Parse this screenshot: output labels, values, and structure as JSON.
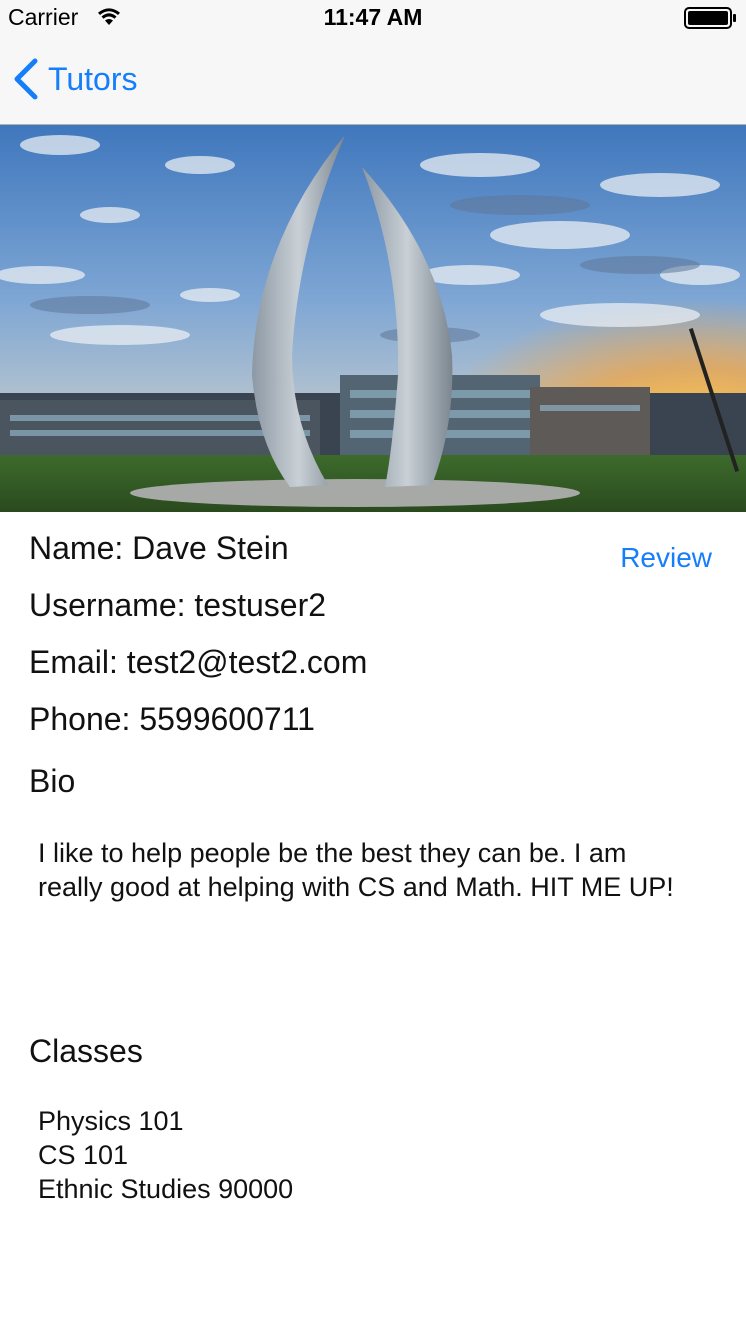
{
  "status_bar": {
    "carrier": "Carrier",
    "time": "11:47 AM"
  },
  "nav": {
    "back_label": "Tutors",
    "accent_color": "#157efb"
  },
  "hero_image": {
    "description_icon": "campus-sculpture-photo"
  },
  "profile": {
    "name": "Name: Dave Stein",
    "username": "Username: testuser2",
    "email": "Email: test2@test2.com",
    "phone": "Phone: 5599600711",
    "review_label": "Review"
  },
  "bio": {
    "title": "Bio",
    "text": "I like to help people be the best they can be. I am really good at helping with CS and Math. HIT ME UP!"
  },
  "classes": {
    "title": "Classes",
    "items": [
      "Physics 101",
      "CS 101",
      "Ethnic Studies 90000"
    ]
  }
}
